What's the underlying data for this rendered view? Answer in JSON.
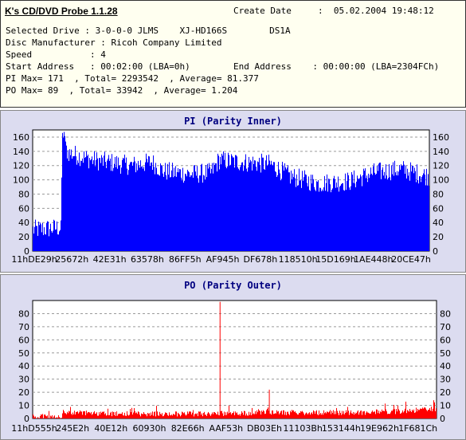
{
  "app": {
    "title": "K's CD/DVD Probe 1.1.28"
  },
  "info": {
    "create_date_label": "Create Date",
    "create_date_value": ":  05.02.2004 19:48:12",
    "lines": [
      "Selected Drive : 3-0-0-0 JLMS    XJ-HD166S        DS1A",
      "Disc Manufacturer : Ricoh Company Limited",
      "Speed           : 4",
      "Start Address   : 00:02:00 (LBA=0h)",
      "PI Max= 171  , Total= 2293542  , Average= 81.377",
      "PO Max= 89  , Total= 33942  , Average= 1.204"
    ],
    "end_address": "End Address    : 00:00:00 (LBA=2304FCh)"
  },
  "chart_data": [
    {
      "type": "bar",
      "title": "PI (Parity Inner)",
      "color": "#0000ff",
      "ylim": [
        0,
        170
      ],
      "yticks": [
        0,
        20,
        40,
        60,
        80,
        100,
        120,
        140,
        160
      ],
      "xticks": [
        "11hDE29h",
        "25672h",
        "42E31h",
        "63578h",
        "86FF5h",
        "AF945h",
        "DF678h",
        "118510h",
        "15D169h",
        "1AE448h",
        "20CE47h"
      ],
      "grid": true,
      "profile": [
        {
          "x": 0.0,
          "y": 30
        },
        {
          "x": 0.07,
          "y": 33
        },
        {
          "x": 0.075,
          "y": 150
        },
        {
          "x": 0.09,
          "y": 138
        },
        {
          "x": 0.15,
          "y": 128
        },
        {
          "x": 0.25,
          "y": 120
        },
        {
          "x": 0.3,
          "y": 125
        },
        {
          "x": 0.33,
          "y": 112
        },
        {
          "x": 0.4,
          "y": 108
        },
        {
          "x": 0.45,
          "y": 110
        },
        {
          "x": 0.47,
          "y": 128
        },
        {
          "x": 0.5,
          "y": 126
        },
        {
          "x": 0.55,
          "y": 124
        },
        {
          "x": 0.6,
          "y": 122
        },
        {
          "x": 0.65,
          "y": 105
        },
        {
          "x": 0.72,
          "y": 95
        },
        {
          "x": 0.8,
          "y": 98
        },
        {
          "x": 0.86,
          "y": 110
        },
        {
          "x": 0.93,
          "y": 115
        },
        {
          "x": 1.0,
          "y": 105
        }
      ],
      "max": 171
    },
    {
      "type": "bar",
      "title": "PO (Parity Outer)",
      "color": "#ff0000",
      "ylim": [
        0,
        90
      ],
      "yticks": [
        0,
        10,
        20,
        30,
        40,
        50,
        60,
        70,
        80
      ],
      "xticks": [
        "11hD555h",
        "245E2h",
        "40E12h",
        "60930h",
        "82E66h",
        "AAF53h",
        "DB03Eh",
        "11103Bh",
        "153144h",
        "19E962h",
        "1F681Ch"
      ],
      "grid": true,
      "profile": [
        {
          "x": 0.0,
          "y": 1
        },
        {
          "x": 0.07,
          "y": 1
        },
        {
          "x": 0.075,
          "y": 4
        },
        {
          "x": 0.2,
          "y": 3
        },
        {
          "x": 0.4,
          "y": 3
        },
        {
          "x": 0.6,
          "y": 4
        },
        {
          "x": 0.8,
          "y": 4
        },
        {
          "x": 0.92,
          "y": 5
        },
        {
          "x": 1.0,
          "y": 7
        }
      ],
      "spikes": [
        {
          "x": 0.463,
          "y": 89
        },
        {
          "x": 0.585,
          "y": 22
        }
      ],
      "max": 89
    }
  ]
}
